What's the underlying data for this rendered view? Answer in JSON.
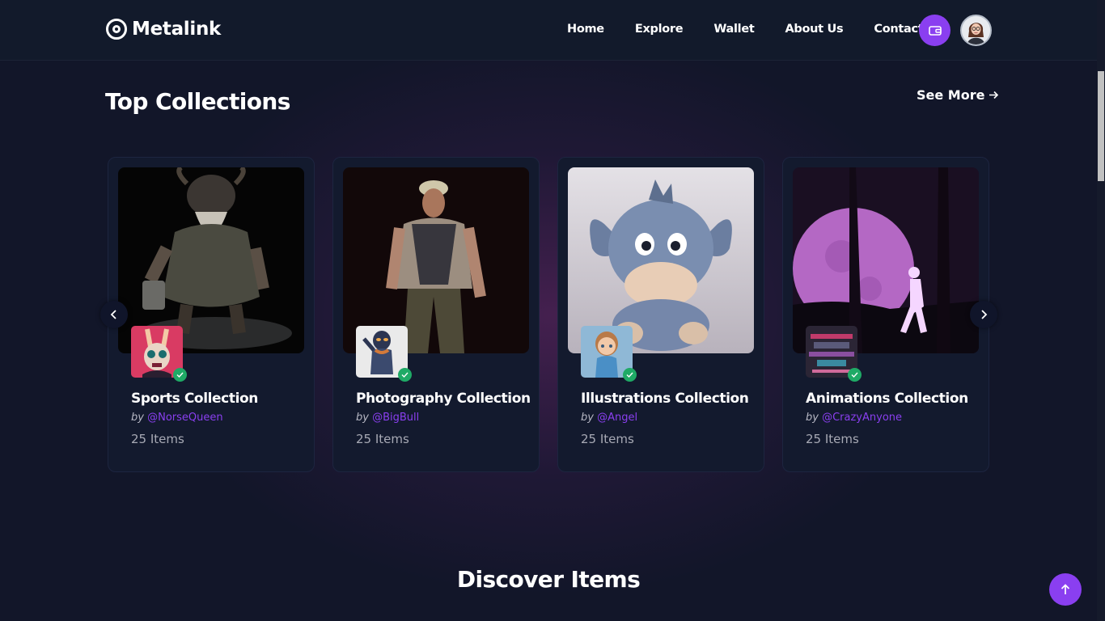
{
  "brand": {
    "name": "Metalink",
    "accent": "#8a3ff0",
    "verified": "#1faa66"
  },
  "nav": [
    "Home",
    "Explore",
    "Wallet",
    "About Us",
    "Contact"
  ],
  "header_icons": {
    "wallet": "wallet-icon",
    "avatar": "user-avatar"
  },
  "section": {
    "title": "Top Collections",
    "see_more": "See More"
  },
  "collections": [
    {
      "name": "Sports Collection",
      "by": "by",
      "handle": "@NorseQueen",
      "items": "25 Items",
      "image": "viking-warrior-image",
      "thumb": "rabbit-mask-thumb"
    },
    {
      "name": "Photography Collection",
      "by": "by",
      "handle": "@BigBull",
      "items": "25 Items",
      "image": "worker-man-image",
      "thumb": "alien-figure-thumb"
    },
    {
      "name": "Illustrations Collection",
      "by": "by",
      "handle": "@Angel",
      "items": "25 Items",
      "image": "plush-donkey-image",
      "thumb": "girl-figure-thumb"
    },
    {
      "name": "Animations Collection",
      "by": "by",
      "handle": "@CrazyAnyone",
      "items": "25 Items",
      "image": "moon-silhouette-image",
      "thumb": "glitch-art-thumb"
    }
  ],
  "discover": {
    "title": "Discover Items"
  }
}
